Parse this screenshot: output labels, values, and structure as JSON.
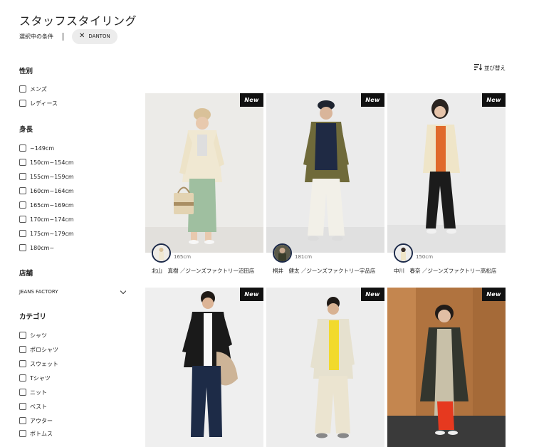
{
  "page": {
    "title": "スタッフスタイリング"
  },
  "conditions": {
    "label": "選択中の条件",
    "chip": "DANTON"
  },
  "filters": {
    "gender": {
      "title": "性別",
      "options": [
        "メンズ",
        "レディース"
      ]
    },
    "height": {
      "title": "身長",
      "options": [
        "~149cm",
        "150cm~154cm",
        "155cm~159cm",
        "160cm~164cm",
        "165cm~169cm",
        "170cm~174cm",
        "175cm~179cm",
        "180cm~"
      ]
    },
    "store": {
      "title": "店舗",
      "selected": "JEANS FACTORY"
    },
    "category": {
      "title": "カテゴリ",
      "options": [
        "シャツ",
        "ポロシャツ",
        "スウェット",
        "Tシャツ",
        "ニット",
        "ベスト",
        "アウター",
        "ボトムス"
      ]
    }
  },
  "sort": {
    "label": "並び替え"
  },
  "cards": [
    {
      "badge": "New",
      "height": "165cm",
      "staff": "北山　真樹 ／ジーンズファクトリー沼田店"
    },
    {
      "badge": "New",
      "height": "181cm",
      "staff": "桐井　健太 ／ジーンズファクトリー宇品店"
    },
    {
      "badge": "New",
      "height": "150cm",
      "staff": "中川　春奈 ／ジーンズファクトリー高松店"
    },
    {
      "badge": "New"
    },
    {
      "badge": "New"
    },
    {
      "badge": "New"
    }
  ],
  "colors": {
    "accent": "#1c2a4a",
    "badge_bg": "#111111",
    "chip_bg": "#ececec"
  },
  "icons": {
    "chip_remove": "close-icon",
    "sort": "sort-icon",
    "store_dropdown": "chevron-down-icon"
  }
}
